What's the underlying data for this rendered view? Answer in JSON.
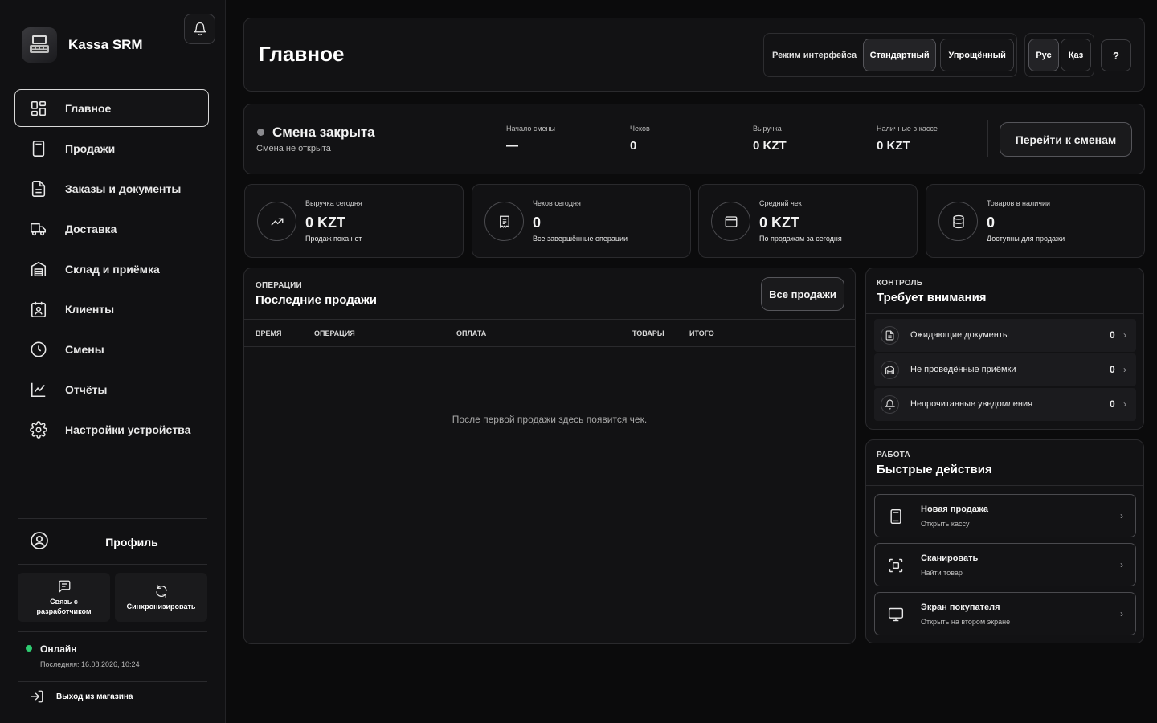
{
  "app": {
    "name": "Kassa SRM"
  },
  "sidebar": {
    "items": [
      {
        "label": "Главное",
        "icon": "dashboard-icon"
      },
      {
        "label": "Продажи",
        "icon": "calculator-icon"
      },
      {
        "label": "Заказы и документы",
        "icon": "document-icon"
      },
      {
        "label": "Доставка",
        "icon": "truck-icon"
      },
      {
        "label": "Склад и приёмка",
        "icon": "warehouse-icon"
      },
      {
        "label": "Клиенты",
        "icon": "client-card-icon"
      },
      {
        "label": "Смены",
        "icon": "clock-icon"
      },
      {
        "label": "Отчёты",
        "icon": "chart-line-icon"
      },
      {
        "label": "Настройки устройства",
        "icon": "gear-icon"
      }
    ],
    "profile_label": "Профиль",
    "contact_dev_label": "Связь с разработчиком",
    "sync_label": "Синхронизировать",
    "status_title": "Онлайн",
    "status_sub": "Последняя: 16.08.2026, 10:24",
    "logout_label": "Выход из магазина"
  },
  "header": {
    "title": "Главное",
    "mode_label": "Режим интерфейса",
    "mode_standard": "Стандартный",
    "mode_simple": "Упрощённый",
    "lang_ru": "Рус",
    "lang_kz": "Қаз",
    "help": "?"
  },
  "shift": {
    "title": "Смена закрыта",
    "subtitle": "Смена не открыта",
    "start_label": "Начало смены",
    "start_value": "—",
    "checks_label": "Чеков",
    "checks_value": "0",
    "revenue_label": "Выручка",
    "revenue_value": "0 KZT",
    "cash_label": "Наличные в кассе",
    "cash_value": "0 KZT",
    "go_button": "Перейти к сменам"
  },
  "kpis": [
    {
      "label": "Выручка сегодня",
      "value": "0 KZT",
      "sub": "Продаж пока нет",
      "icon": "trend-up-icon"
    },
    {
      "label": "Чеков сегодня",
      "value": "0",
      "sub": "Все завершённые операции",
      "icon": "receipt-icon"
    },
    {
      "label": "Средний чек",
      "value": "0 KZT",
      "sub": "По продажам за сегодня",
      "icon": "wallet-icon"
    },
    {
      "label": "Товаров в наличии",
      "value": "0",
      "sub": "Доступны для продажи",
      "icon": "database-icon"
    }
  ],
  "sales": {
    "eyebrow": "ОПЕРАЦИИ",
    "title": "Последние продажи",
    "all_button": "Все продажи",
    "columns": [
      "ВРЕМЯ",
      "ОПЕРАЦИЯ",
      "ОПЛАТА",
      "ТОВАРЫ",
      "ИТОГО"
    ],
    "empty": "После первой продажи здесь появится чек."
  },
  "control": {
    "eyebrow": "КОНТРОЛЬ",
    "title": "Требует внимания",
    "rows": [
      {
        "label": "Ожидающие документы",
        "count": "0",
        "icon": "document-icon"
      },
      {
        "label": "Не проведённые приёмки",
        "count": "0",
        "icon": "warehouse-icon"
      },
      {
        "label": "Непрочитанные уведомления",
        "count": "0",
        "icon": "bell-icon"
      }
    ]
  },
  "quick": {
    "eyebrow": "РАБОТА",
    "title": "Быстрые действия",
    "actions": [
      {
        "title": "Новая продажа",
        "sub": "Открыть кассу",
        "icon": "calculator-icon"
      },
      {
        "title": "Сканировать",
        "sub": "Найти товар",
        "icon": "scan-icon"
      },
      {
        "title": "Экран покупателя",
        "sub": "Открыть на втором экране",
        "icon": "monitor-icon"
      }
    ]
  }
}
